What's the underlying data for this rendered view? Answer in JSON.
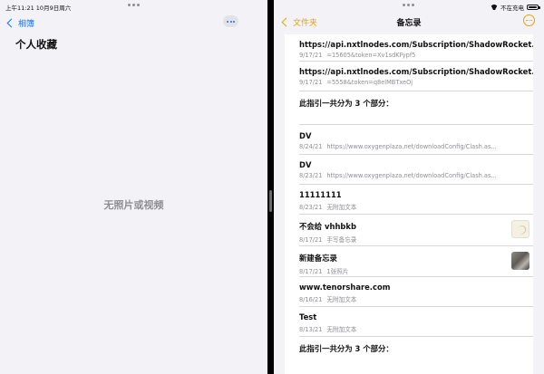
{
  "photos_pane": {
    "status_left": "上午11:21  10月9日周六",
    "back_label": "相簿",
    "album_title": "个人收藏",
    "empty_message": "无照片或视频"
  },
  "notes_pane": {
    "status_right": "不在充电",
    "back_label": "文件夹",
    "title": "备忘录",
    "notes": [
      {
        "title": "https://api.nxtlnodes.com/Subscription/ShadowRocket...",
        "date": "9/17/21",
        "preview": "=15605&token=Xv1sdKFypf5"
      },
      {
        "title": "https://api.nxtlnodes.com/Subscription/ShadowRocket...",
        "date": "9/17/21",
        "preview": "=5558&token=q8elMBTxeOj"
      },
      {
        "title": "此指引一共分为 3 个部分：",
        "date": "",
        "preview": ""
      },
      {
        "title": "DV",
        "date": "8/24/21",
        "preview": "https://www.oxygenplaza.net/downloadConfig/Clash.as..."
      },
      {
        "title": "DV",
        "date": "8/23/21",
        "preview": "https://www.oxygenplaza.net/downloadConfig/Clash.as..."
      },
      {
        "title": "11111111",
        "date": "8/23/21",
        "preview": "无附加文本"
      },
      {
        "title": "不会给 vhhbkb",
        "date": "8/17/21",
        "preview": "手写备忘录"
      },
      {
        "title": "新建备忘录",
        "date": "8/17/21",
        "preview": "1张照片"
      },
      {
        "title": "www.tenorshare.com",
        "date": "8/16/21",
        "preview": "无附加文本"
      },
      {
        "title": "Test",
        "date": "8/13/21",
        "preview": "无附加文本"
      },
      {
        "title": "此指引一共分为 3 个部分：",
        "date": "",
        "preview": ""
      }
    ]
  },
  "colors": {
    "notes_accent": "#e6a400",
    "photos_accent": "#1a73e8",
    "background": "#f2f2f7"
  }
}
